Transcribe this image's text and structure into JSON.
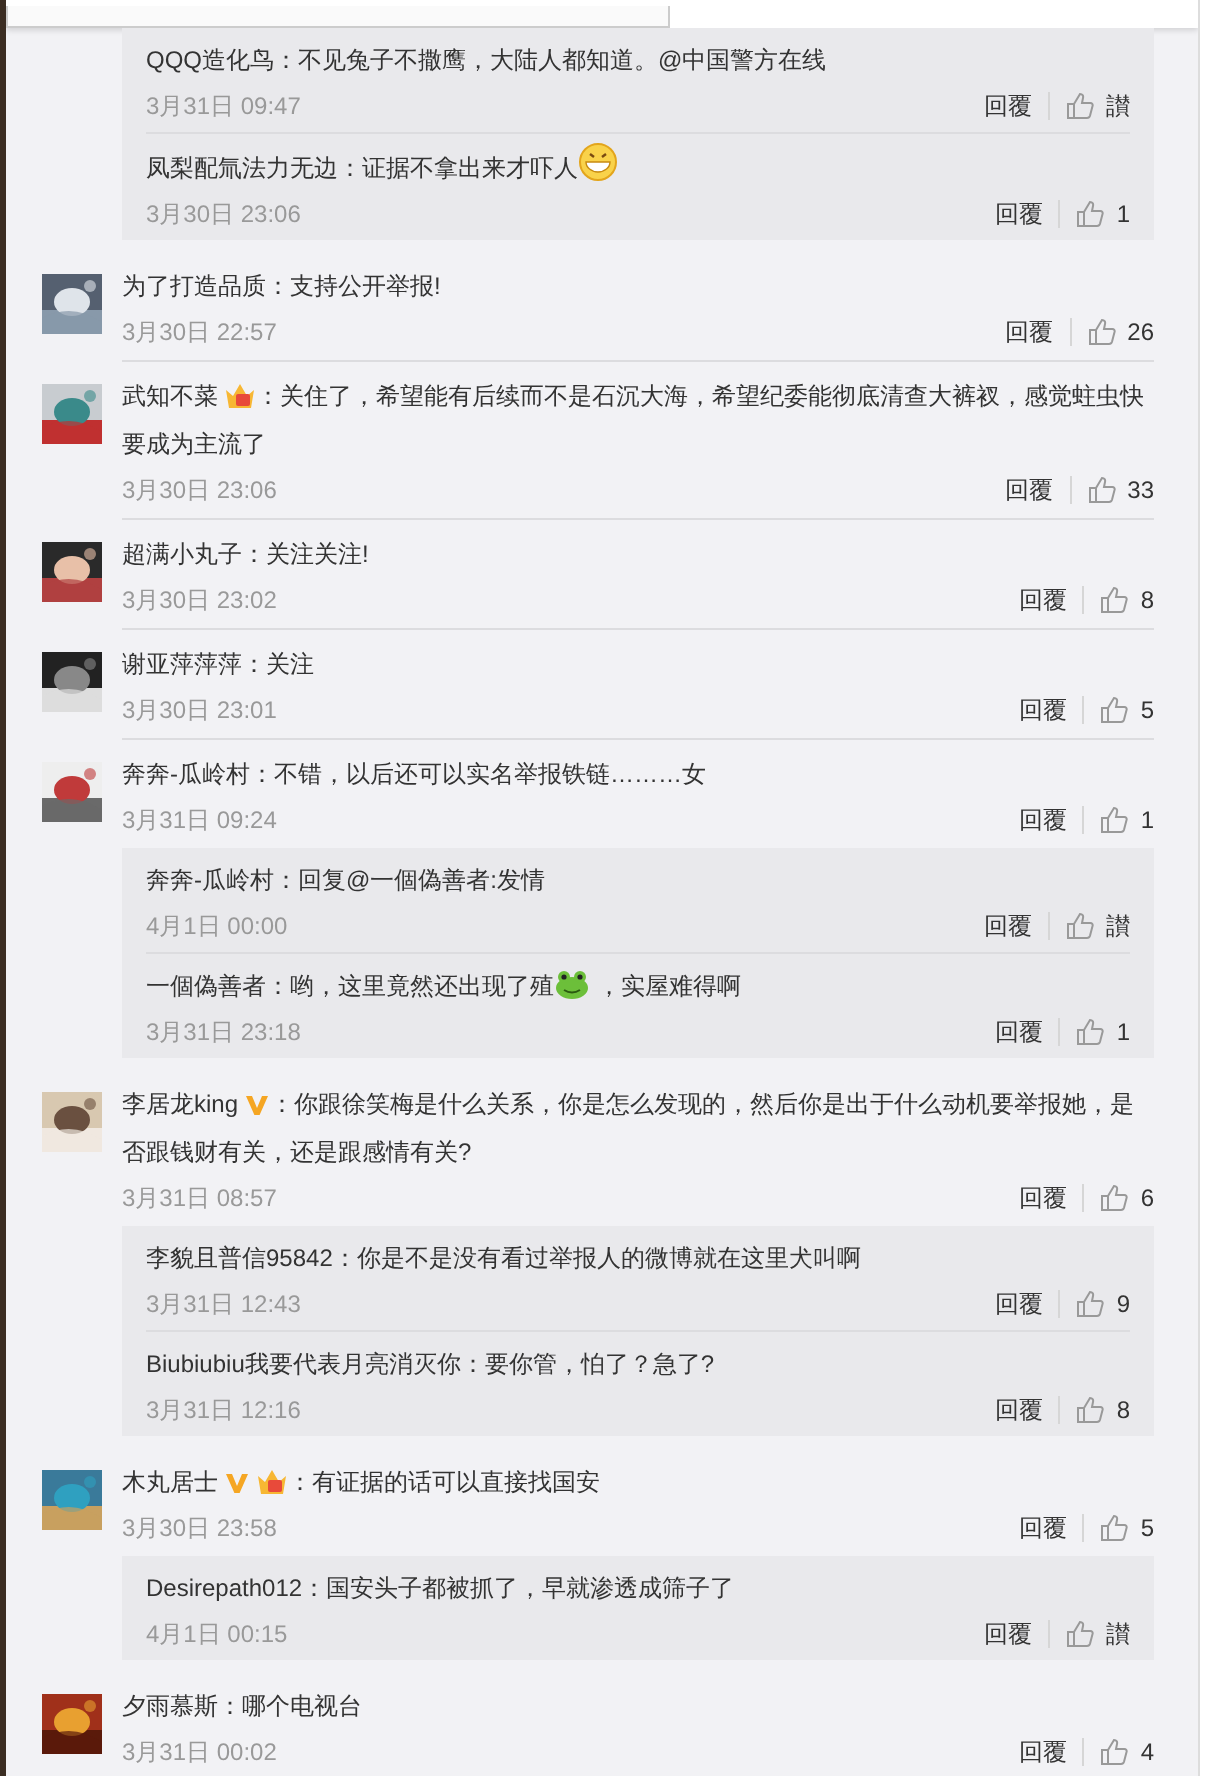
{
  "threads": [
    {
      "replies": [
        {
          "name": "QQQ造化鸟",
          "text": "：不见兔子不撒鹰，大陆人都知道。@中国警方在线",
          "time": "3月31日 09:47",
          "reply": "回覆",
          "likes": "讃"
        },
        {
          "name": "凤梨配氚法力无边",
          "text": "：证据不拿出来才吓人",
          "emoji": {
            "kind": "grin"
          },
          "time": "3月30日 23:06",
          "reply": "回覆",
          "likes": "1"
        }
      ]
    },
    {
      "comment": {
        "name": "为了打造品质",
        "text": "：支持公开举报!",
        "time": "3月30日 22:57",
        "reply": "回覆",
        "likes": "26"
      }
    },
    {
      "comment": {
        "name": "武知不菜",
        "badges": [
          {
            "kind": "crown"
          }
        ],
        "text": "：关住了，希望能有后续而不是石沉大海，希望纪委能彻底清查大裤衩，感觉蛀虫快要成为主流了",
        "time": "3月30日 23:06",
        "reply": "回覆",
        "likes": "33"
      }
    },
    {
      "comment": {
        "name": "超满小丸子",
        "text": "：关注关注!",
        "time": "3月30日 23:02",
        "reply": "回覆",
        "likes": "8"
      }
    },
    {
      "comment": {
        "name": "谢亚萍萍萍",
        "text": "：关注",
        "time": "3月30日 23:01",
        "reply": "回覆",
        "likes": "5"
      }
    },
    {
      "comment": {
        "name": "奔奔-瓜岭村",
        "text": "：不错，以后还可以实名举报铁链………女",
        "time": "3月31日 09:24",
        "reply": "回覆",
        "likes": "1"
      },
      "replies": [
        {
          "name": "奔奔-瓜岭村",
          "text": "：回复@一個偽善者:发情",
          "time": "4月1日 00:00",
          "reply": "回覆",
          "likes": "讃"
        },
        {
          "name": "一個偽善者",
          "text": "：哟，这里竟然还出现了殖",
          "emoji": {
            "kind": "frog"
          },
          "text_after": " ，实屋难得啊",
          "time": "3月31日 23:18",
          "reply": "回覆",
          "likes": "1"
        }
      ]
    },
    {
      "comment": {
        "name": "李居龙king",
        "badges": [
          {
            "kind": "vip"
          }
        ],
        "text": "：你跟徐笑梅是什么关系，你是怎么发现的，然后你是出于什么动机要举报她，是否跟钱财有关，还是跟感情有关?",
        "time": "3月31日 08:57",
        "reply": "回覆",
        "likes": "6"
      },
      "replies": [
        {
          "name": "李貌且普信95842",
          "text": "：你是不是没有看过举报人的微博就在这里犬叫啊",
          "time": "3月31日 12:43",
          "reply": "回覆",
          "likes": "9"
        },
        {
          "name": "Biubiubiu我要代表月亮消灭你",
          "text": "：要你管，怕了？急了?",
          "time": "3月31日 12:16",
          "reply": "回覆",
          "likes": "8"
        }
      ]
    },
    {
      "comment": {
        "name": "木丸居士",
        "badges": [
          {
            "kind": "vip"
          },
          {
            "kind": "crown"
          }
        ],
        "text": "：有证据的话可以直接找国安",
        "time": "3月30日 23:58",
        "reply": "回覆",
        "likes": "5"
      },
      "replies": [
        {
          "name": "Desirepath012",
          "text": "：国安头子都被抓了，早就渗透成筛子了",
          "time": "4月1日 00:15",
          "reply": "回覆",
          "likes": "讃"
        }
      ]
    },
    {
      "comment": {
        "name": "夕雨慕斯",
        "text": "：哪个电视台",
        "time": "3月31日 00:02",
        "reply": "回覆",
        "likes": "4"
      }
    }
  ]
}
